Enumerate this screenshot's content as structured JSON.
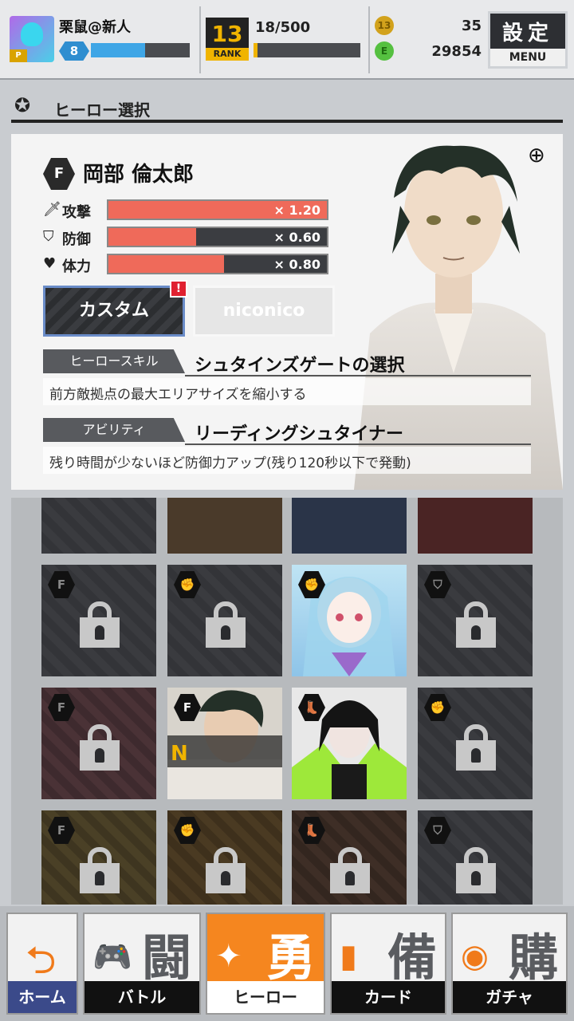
{
  "header": {
    "user_name": "栗鼠@新人",
    "user_level": "8",
    "exp_progress": 0.55,
    "rank_number": "13",
    "rank_label": "RANK",
    "rank_count": "18/500",
    "rank_progress": 0.04,
    "coin_gold_icon": "13",
    "coin_gold": "35",
    "coin_green_icon": "E",
    "coin_green": "29854",
    "menu_kanji": "設定",
    "menu_label": "MENU"
  },
  "title_bar": {
    "title": "ヒーロー選択"
  },
  "hero": {
    "type_icon": "F",
    "name": "岡部 倫太郎",
    "stats": [
      {
        "label": "攻撃",
        "icon": "sword-icon",
        "value": "× 1.20",
        "fill": 1.0
      },
      {
        "label": "防御",
        "icon": "shield-icon",
        "value": "× 0.60",
        "fill": 0.4
      },
      {
        "label": "体力",
        "icon": "heart-icon",
        "value": "× 0.80",
        "fill": 0.53
      }
    ],
    "custom_button": "カスタム",
    "custom_alert": "!",
    "niconico_button": "niconico",
    "skill_tag": "ヒーロースキル",
    "skill_name": "シュタインズゲートの選択",
    "skill_desc": "前方敵拠点の最大エリアサイズを縮小する",
    "ability_tag": "アビリティ",
    "ability_name": "リーディングシュタイナー",
    "ability_desc": "残り時間が少ないほど防御力アップ(残り120秒以下で発動)"
  },
  "grid": {
    "selected_rarity": "N"
  },
  "nav": {
    "tabs": [
      {
        "label": "ホーム",
        "kanji": "",
        "symbol": "⮌"
      },
      {
        "label": "バトル",
        "kanji": "闘",
        "symbol": "🎮"
      },
      {
        "label": "ヒーロー",
        "kanji": "勇",
        "symbol": "✦"
      },
      {
        "label": "カード",
        "kanji": "備",
        "symbol": "▮"
      },
      {
        "label": "ガチャ",
        "kanji": "購",
        "symbol": "◉"
      }
    ]
  },
  "colors": {
    "accent_orange": "#f5861f",
    "stat_fill": "#ef6a5a",
    "exp_blue": "#3fa6e6",
    "rank_gold": "#f0b400"
  }
}
